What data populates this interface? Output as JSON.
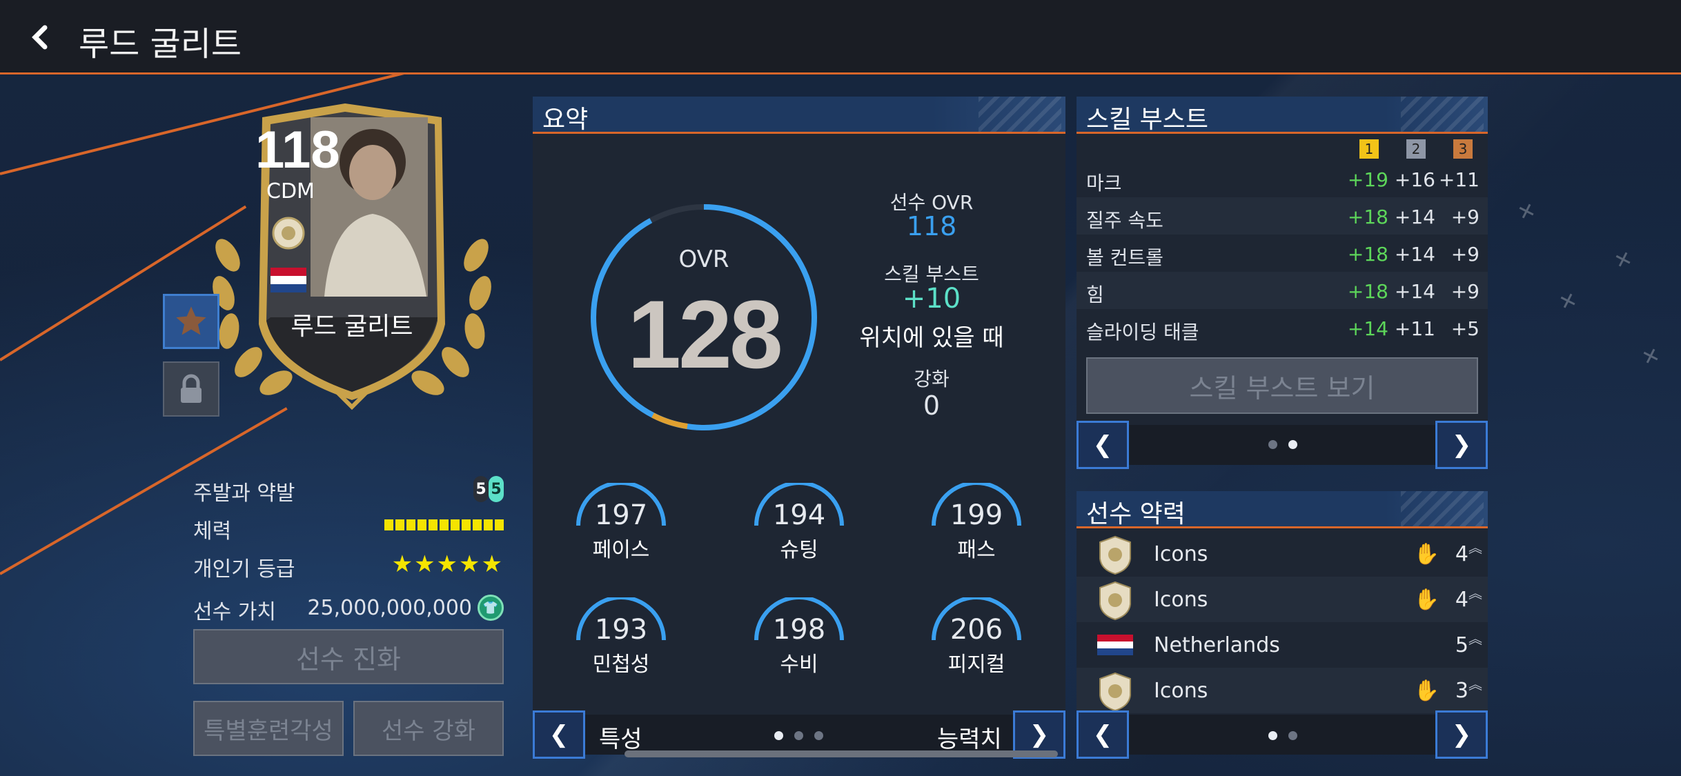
{
  "header": {
    "title": "루드 굴리트",
    "back_icon": "chevron-left-icon"
  },
  "card": {
    "ovr": "118",
    "position": "CDM",
    "name": "루드 굴리트"
  },
  "player_info": {
    "foot_label": "주발과 약발",
    "foot_left": "5",
    "foot_right": "5",
    "stamina_label": "체력",
    "stamina_level": 1.0,
    "popularity_label": "개인기 등급",
    "popularity_stars": "★★★★★",
    "value_label": "선수 가치",
    "value": "25,000,000,000"
  },
  "buttons": {
    "evolve": "선수 진화",
    "special_training": "특별훈련각성",
    "enhance": "선수 강화"
  },
  "summary": {
    "title": "요약",
    "ovr_label": "OVR",
    "ovr_value": "128",
    "ovr_fraction": 0.92,
    "player_ovr_label": "선수 OVR",
    "player_ovr_value": "118",
    "skill_boost_label": "스킬 부스트",
    "skill_boost_value": "+10",
    "position_note": "위치에 있을 때",
    "enhance_label": "강화",
    "enhance_value": "0",
    "stats": [
      {
        "label": "페이스",
        "value": "197"
      },
      {
        "label": "슈팅",
        "value": "194"
      },
      {
        "label": "패스",
        "value": "199"
      },
      {
        "label": "민첩성",
        "value": "193"
      },
      {
        "label": "수비",
        "value": "198"
      },
      {
        "label": "피지컬",
        "value": "206"
      }
    ],
    "footer_left": "특성",
    "footer_right": "능력치",
    "page_index": 0,
    "page_count": 3
  },
  "skill_boost": {
    "title": "스킬 부스트",
    "ranks": [
      "1",
      "2",
      "3"
    ],
    "rank_colors": [
      "#f2c318",
      "#8e96a6",
      "#c97a3d"
    ],
    "rows": [
      {
        "name": "마크",
        "v1": "+19",
        "v2": "+16",
        "v3": "+11"
      },
      {
        "name": "질주 속도",
        "v1": "+18",
        "v2": "+14",
        "v3": "+9"
      },
      {
        "name": "볼 컨트롤",
        "v1": "+18",
        "v2": "+14",
        "v3": "+9"
      },
      {
        "name": "힘",
        "v1": "+18",
        "v2": "+14",
        "v3": "+9"
      },
      {
        "name": "슬라이딩 태클",
        "v1": "+14",
        "v2": "+11",
        "v3": "+5"
      }
    ],
    "view_button": "스킬 부스트 보기",
    "page_index": 1,
    "page_count": 2
  },
  "chemistry": {
    "title": "선수 약력",
    "rows": [
      {
        "icon": "icons-badge-icon",
        "name": "Icons",
        "level": "4",
        "hand": true
      },
      {
        "icon": "icons-badge-icon",
        "name": "Icons",
        "level": "4",
        "hand": true
      },
      {
        "icon": "netherlands-flag-icon",
        "name": "Netherlands",
        "level": "5",
        "hand": false
      },
      {
        "icon": "icons-badge-icon",
        "name": "Icons",
        "level": "3",
        "hand": true
      }
    ],
    "page_index": 0,
    "page_count": 2
  },
  "colors": {
    "accent_orange": "#d8662a",
    "ring_blue": "#3aa0f0",
    "ring_gold": "#e0a030",
    "positive_green": "#5dd65a",
    "teal": "#5ce0c8"
  }
}
